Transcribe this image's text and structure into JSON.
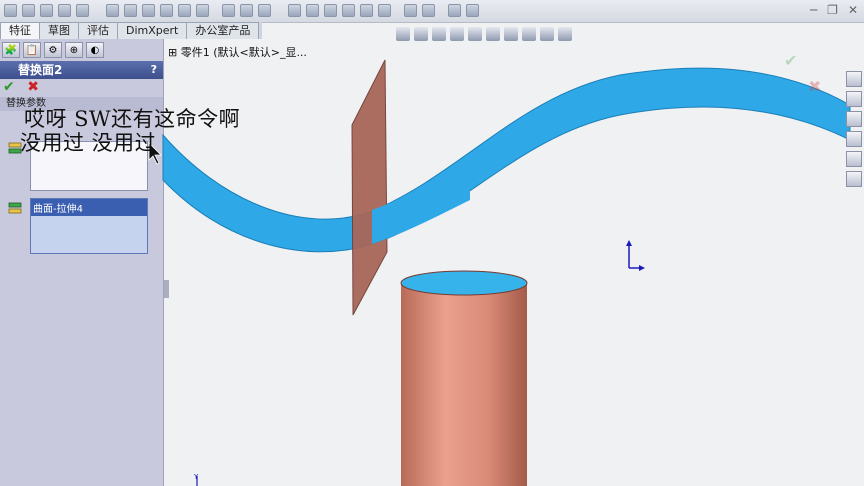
{
  "window": {
    "controls": [
      "─",
      "❐",
      "✕"
    ]
  },
  "tabs": [
    {
      "label": "特征",
      "active": true
    },
    {
      "label": "草图",
      "active": false
    },
    {
      "label": "评估",
      "active": false
    },
    {
      "label": "DimXpert",
      "active": false
    },
    {
      "label": "办公室产品",
      "active": false
    }
  ],
  "property_manager": {
    "title": "替换面2",
    "help": "?",
    "ok_icon": "✔",
    "cancel_icon": "✖",
    "group_label": "替换参数",
    "replacement_face": "曲面-拉伸4"
  },
  "tree": {
    "path": "零件1  (默认<默认>_显..."
  },
  "captions": {
    "line1": "哎呀 SW还有这命令啊",
    "line2": "没用过 没用过"
  },
  "colors": {
    "surface_blue": "#2ea8e6",
    "plane_brown": "#a9665a",
    "cylinder_copper": "#d98a76",
    "panel_bg": "#c9c9dd"
  }
}
